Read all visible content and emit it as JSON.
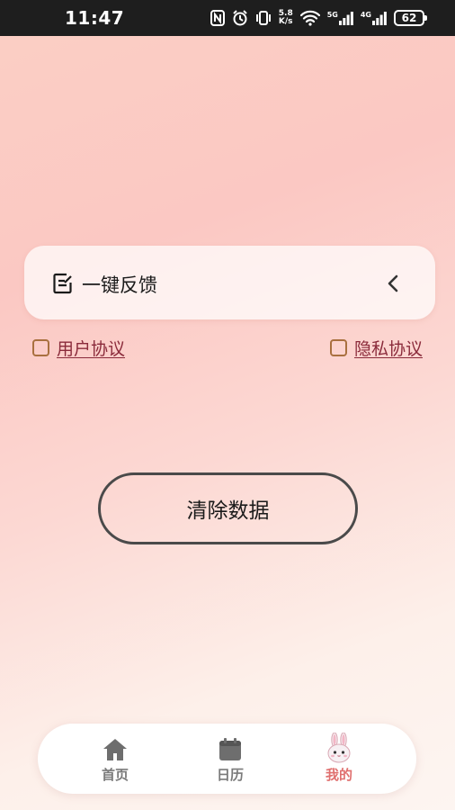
{
  "status_bar": {
    "time": "11:47",
    "net_speed_value": "5.8",
    "net_speed_unit": "K/s",
    "sim1_label": "5G",
    "sim2_label": "4G",
    "battery": "62",
    "icons": [
      "nfc-icon",
      "alarm-icon",
      "vibrate-icon",
      "wifi-icon",
      "signal-icon",
      "battery-icon"
    ]
  },
  "feedback": {
    "icon": "edit-note-icon",
    "label": "一键反馈",
    "arrow_icon": "chevron-left-icon"
  },
  "agreements": {
    "user": {
      "label": "用户协议",
      "checked": false
    },
    "privacy": {
      "label": "隐私协议",
      "checked": false
    }
  },
  "actions": {
    "clear_label": "清除数据"
  },
  "tab_bar": {
    "tabs": [
      {
        "label": "首页",
        "icon": "home-icon",
        "active": false
      },
      {
        "label": "日历",
        "icon": "calendar-icon",
        "active": false
      },
      {
        "label": "我的",
        "icon": "bunny-icon",
        "active": true
      }
    ]
  },
  "colors": {
    "accent": "#e0706f",
    "link": "#8a2a3a",
    "checkbox_border": "#a9703f",
    "button_border": "#4a4a4a"
  }
}
